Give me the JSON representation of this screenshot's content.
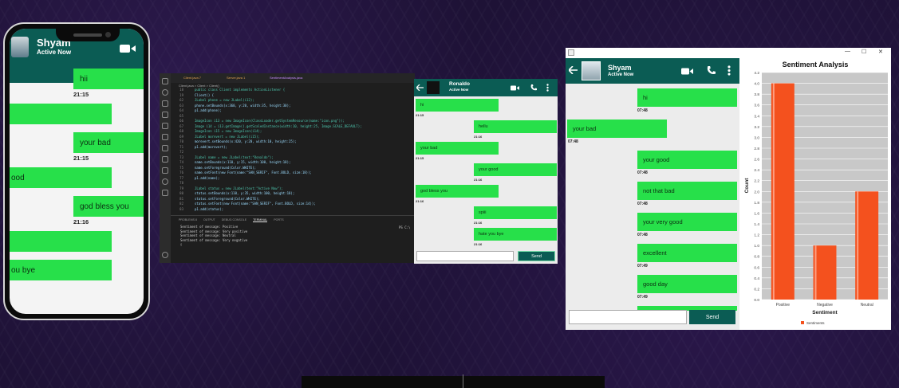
{
  "phone": {
    "contact_name": "Shyam",
    "status": "Active Now",
    "messages": [
      {
        "text": "hii",
        "time": "21:15"
      },
      {
        "text": ""
      },
      {
        "text": "your bad",
        "time": "21:15"
      },
      {
        "text": "ood"
      },
      {
        "text": "god bless you",
        "time": "21:16"
      },
      {
        "text": ""
      },
      {
        "text": "ou bye"
      }
    ]
  },
  "vscode": {
    "tabs": [
      "Client.java 7",
      "Server.java 1",
      "SentimentAnalysis.java"
    ],
    "breadcrumb": "Client.java > Client > Client()",
    "code_lines": [
      {
        "n": "18",
        "t": "public class Client implements ActionListener {"
      },
      {
        "n": "19",
        "t": "    Client() {"
      },
      {
        "n": "62",
        "t": "        JLabel phone = new JLabel(i12);"
      },
      {
        "n": "63",
        "t": "        phone.setBounds(x:360, y:20, width:35, height:30);"
      },
      {
        "n": "64",
        "t": "        p1.add(phone);"
      },
      {
        "n": "65",
        "t": ""
      },
      {
        "n": "66",
        "t": "        ImageIcon i13 = new ImageIcon(ClassLoader.getSystemResource(name:\"icon.png\"));"
      },
      {
        "n": "67",
        "t": "        Image i14 = i13.getImage().getScaledInstance(width:10, height:25, Image.SCALE_DEFAULT);"
      },
      {
        "n": "68",
        "t": "        ImageIcon i15 = new ImageIcon(i14);"
      },
      {
        "n": "69",
        "t": "        JLabel morevert = new JLabel(i15);"
      },
      {
        "n": "70",
        "t": "        morevert.setBounds(x:420, y:20, width:10, height:25);"
      },
      {
        "n": "71",
        "t": "        p1.add(morevert);"
      },
      {
        "n": "72",
        "t": ""
      },
      {
        "n": "73",
        "t": "        JLabel name = new JLabel(text:\"Ronaldo\");"
      },
      {
        "n": "74",
        "t": "        name.setBounds(x:110, y:15, width:100, height:18);"
      },
      {
        "n": "75",
        "t": "        name.setForeground(Color.WHITE);"
      },
      {
        "n": "76",
        "t": "        name.setFont(new Font(name:\"SAN_SERIF\", Font.BOLD, size:18));"
      },
      {
        "n": "77",
        "t": "        p1.add(name);"
      },
      {
        "n": "78",
        "t": ""
      },
      {
        "n": "79",
        "t": "        JLabel status = new JLabel(text:\"Active Now\");"
      },
      {
        "n": "80",
        "t": "        status.setBounds(x:110, y:35, width:100, height:18);"
      },
      {
        "n": "81",
        "t": "        status.setForeground(Color.WHITE);"
      },
      {
        "n": "82",
        "t": "        status.setFont(new Font(name:\"SAN_SERIF\", Font.BOLD, size:14));"
      },
      {
        "n": "83",
        "t": "        p1.add(status);"
      }
    ],
    "panel_tabs": [
      "PROBLEMS 8",
      "OUTPUT",
      "DEBUG CONSOLE",
      "TERMINAL",
      "PORTS"
    ],
    "terminal_lines": [
      "Sentiment of message: Positive",
      "Sentiment of message: Very positive",
      "Sentiment of message: Neutral",
      "Sentiment of message: Very negative",
      "▯"
    ],
    "terminal_right": "PS C:\\"
  },
  "ronaldo_chat": {
    "contact_name": "Ronaldo",
    "status": "Active Now",
    "messages": [
      {
        "text": "hi",
        "time": "21:15",
        "side": "left"
      },
      {
        "text": "hellu",
        "time": "21:16",
        "side": "right"
      },
      {
        "text": "your bad",
        "time": "21:15",
        "side": "left"
      },
      {
        "text": "your good",
        "time": "21:16",
        "side": "right"
      },
      {
        "text": "god bless you",
        "time": "21:16",
        "side": "left"
      },
      {
        "text": "spiii",
        "time": "21:16",
        "side": "right"
      },
      {
        "text": "hate you bye",
        "time": "21:16",
        "side": "right"
      }
    ],
    "send_label": "Send"
  },
  "desktop_window": {
    "contact_name": "Shyam",
    "status": "Active Now",
    "window_buttons": [
      "—",
      "☐",
      "✕"
    ],
    "messages": [
      {
        "text": "hi",
        "time": "07:48",
        "side": "right"
      },
      {
        "text": "your bad",
        "time": "07:48",
        "side": "left"
      },
      {
        "text": "your good",
        "time": "07:48",
        "side": "right"
      },
      {
        "text": "not that bad",
        "time": "07:48",
        "side": "right"
      },
      {
        "text": "your very good",
        "time": "07:48",
        "side": "right"
      },
      {
        "text": "excellent",
        "time": "07:49",
        "side": "right"
      },
      {
        "text": "good day",
        "time": "07:49",
        "side": "right"
      }
    ],
    "send_label": "Send"
  },
  "chart_data": {
    "type": "bar",
    "title": "Sentiment Analysis",
    "xlabel": "Sentiment",
    "ylabel": "Count",
    "categories": [
      "Positive",
      "Negative",
      "Neutral"
    ],
    "series": [
      {
        "name": "Sentiments",
        "values": [
          4.0,
          1.0,
          2.0
        ]
      }
    ],
    "ylim": [
      0,
      4.2
    ],
    "yticks": [
      "0.0",
      "0.2",
      "0.4",
      "0.6",
      "0.8",
      "1.0",
      "1.2",
      "1.4",
      "1.6",
      "1.8",
      "2.0",
      "2.2",
      "2.4",
      "2.6",
      "2.8",
      "3.0",
      "3.2",
      "3.4",
      "3.6",
      "3.8",
      "4.0",
      "4.2"
    ],
    "grid": true,
    "legend": "bottom",
    "colors": {
      "bar": "#f4511e",
      "plot_bg": "#c8c8c8"
    }
  },
  "colors": {
    "header": "#0b5c54",
    "bubble": "#27e04a",
    "background": "#1e1236"
  }
}
